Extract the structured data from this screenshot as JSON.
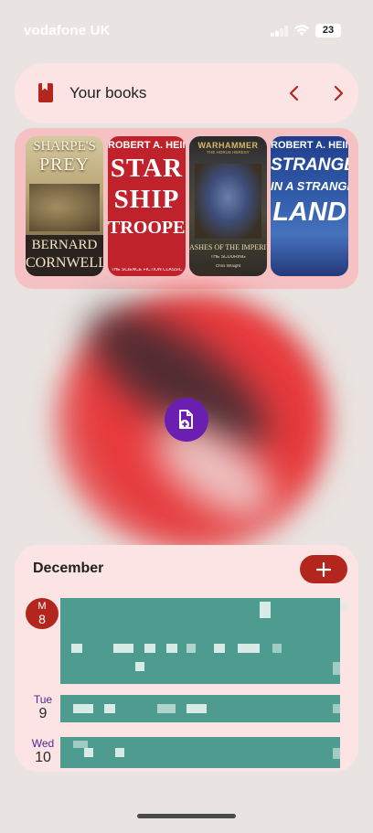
{
  "status_bar": {
    "carrier": "vodafone UK",
    "battery": "23"
  },
  "books_widget": {
    "title": "Your books",
    "prev_icon": "chevron-left-icon",
    "next_icon": "chevron-right-icon",
    "books": [
      {
        "cover_lines": [
          "SHARPE'S",
          "PREY",
          "BERNARD",
          "CORNWELL"
        ]
      },
      {
        "cover_lines": [
          "ROBERT A. HEINLEIN",
          "STAR",
          "SHIP",
          "TROOPERS",
          "THE SCIENCE FICTION CLASSIC"
        ]
      },
      {
        "cover_lines": [
          "WARHAMMER",
          "THE HORUS HERESY",
          "ASHES OF THE IMPERIUM",
          "THE SCOURING",
          "Chris Wraight"
        ]
      },
      {
        "cover_lines": [
          "ROBERT A. HEINLEIN",
          "STRANGER",
          "IN A STRANGE",
          "LAND"
        ]
      }
    ]
  },
  "fab": {
    "icon": "add-document-icon"
  },
  "calendar": {
    "month": "December",
    "add_icon": "plus-icon",
    "days": [
      {
        "day": "M",
        "date": "8",
        "today": true
      },
      {
        "day": "Tue",
        "date": "9",
        "today": false
      },
      {
        "day": "Wed",
        "date": "10",
        "today": false
      }
    ]
  },
  "colors": {
    "accent_red": "#b3261e",
    "widget_pink": "#fbe4e3",
    "fab_purple": "#6a1fb0",
    "event_teal": "#4e9c8f"
  }
}
